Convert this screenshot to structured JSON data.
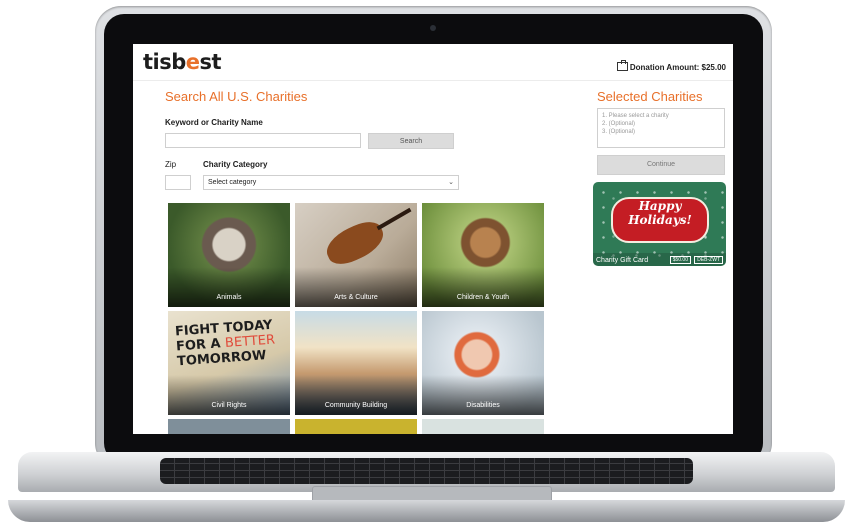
{
  "header": {
    "logo_prefix": "tisb",
    "logo_accent": "e",
    "logo_suffix": "st",
    "donation_amount": "Donation Amount: $25.00"
  },
  "search": {
    "heading": "Search All U.S. Charities",
    "keyword_label": "Keyword or Charity Name",
    "keyword_value": "",
    "search_button": "Search",
    "zip_label": "Zip",
    "zip_value": "",
    "category_label": "Charity Category",
    "category_selected": "Select category"
  },
  "categories": [
    {
      "label": "Animals"
    },
    {
      "label": "Arts & Culture"
    },
    {
      "label": "Children & Youth"
    },
    {
      "label": "Civil Rights"
    },
    {
      "label": "Community Building"
    },
    {
      "label": "Disabilities"
    }
  ],
  "civil_rights_sign": {
    "line1": "FIGHT TODAY",
    "line2a": "FOR A",
    "line2b": "BETTER",
    "line3": "TOMORROW"
  },
  "selected": {
    "heading": "Selected Charities",
    "slots": [
      "1. Please select a charity",
      "2. (Optional)",
      "3. (Optional)"
    ],
    "continue_button": "Continue"
  },
  "gift_card": {
    "greeting_line1": "Happy",
    "greeting_line2": "Holidays!",
    "title": "Charity Gift Card",
    "amount": "$50.00",
    "code": "DEB-ZWT"
  },
  "colors": {
    "accent": "#e8702a",
    "card_green": "#2f7a56",
    "card_red": "#c41d24"
  }
}
